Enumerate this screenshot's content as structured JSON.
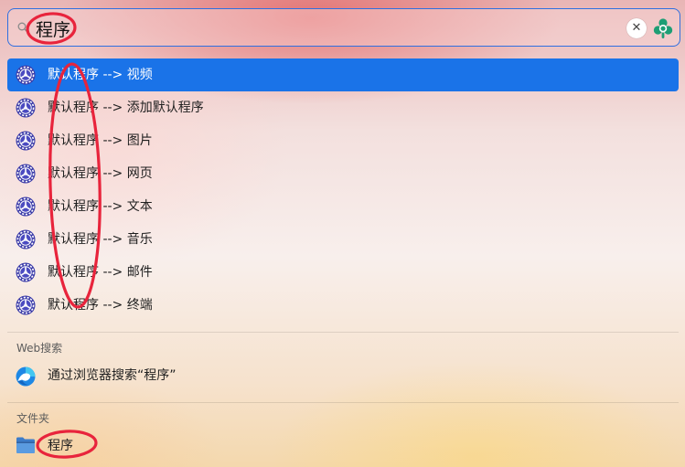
{
  "search": {
    "query": "程序",
    "clear_symbol": "✕"
  },
  "results": [
    {
      "label": "默认程序 --> 视频",
      "icon": "settings-gear-icon",
      "selected": true
    },
    {
      "label": "默认程序 --> 添加默认程序",
      "icon": "settings-gear-icon",
      "selected": false
    },
    {
      "label": "默认程序 --> 图片",
      "icon": "settings-gear-icon",
      "selected": false
    },
    {
      "label": "默认程序 --> 网页",
      "icon": "settings-gear-icon",
      "selected": false
    },
    {
      "label": "默认程序 --> 文本",
      "icon": "settings-gear-icon",
      "selected": false
    },
    {
      "label": "默认程序 --> 音乐",
      "icon": "settings-gear-icon",
      "selected": false
    },
    {
      "label": "默认程序 --> 邮件",
      "icon": "settings-gear-icon",
      "selected": false
    },
    {
      "label": "默认程序 --> 终端",
      "icon": "settings-gear-icon",
      "selected": false
    }
  ],
  "web_section": {
    "title": "Web搜索",
    "item_label": "通过浏览器搜索“程序”",
    "icon": "browser-icon"
  },
  "folder_section": {
    "title": "文件夹",
    "item_label": "程序",
    "icon": "folder-icon"
  },
  "colors": {
    "selection": "#1a73e8",
    "search_border": "#2f6fe0",
    "annotation_red": "#e8243c",
    "gear_icon": "#3a3aa8"
  }
}
